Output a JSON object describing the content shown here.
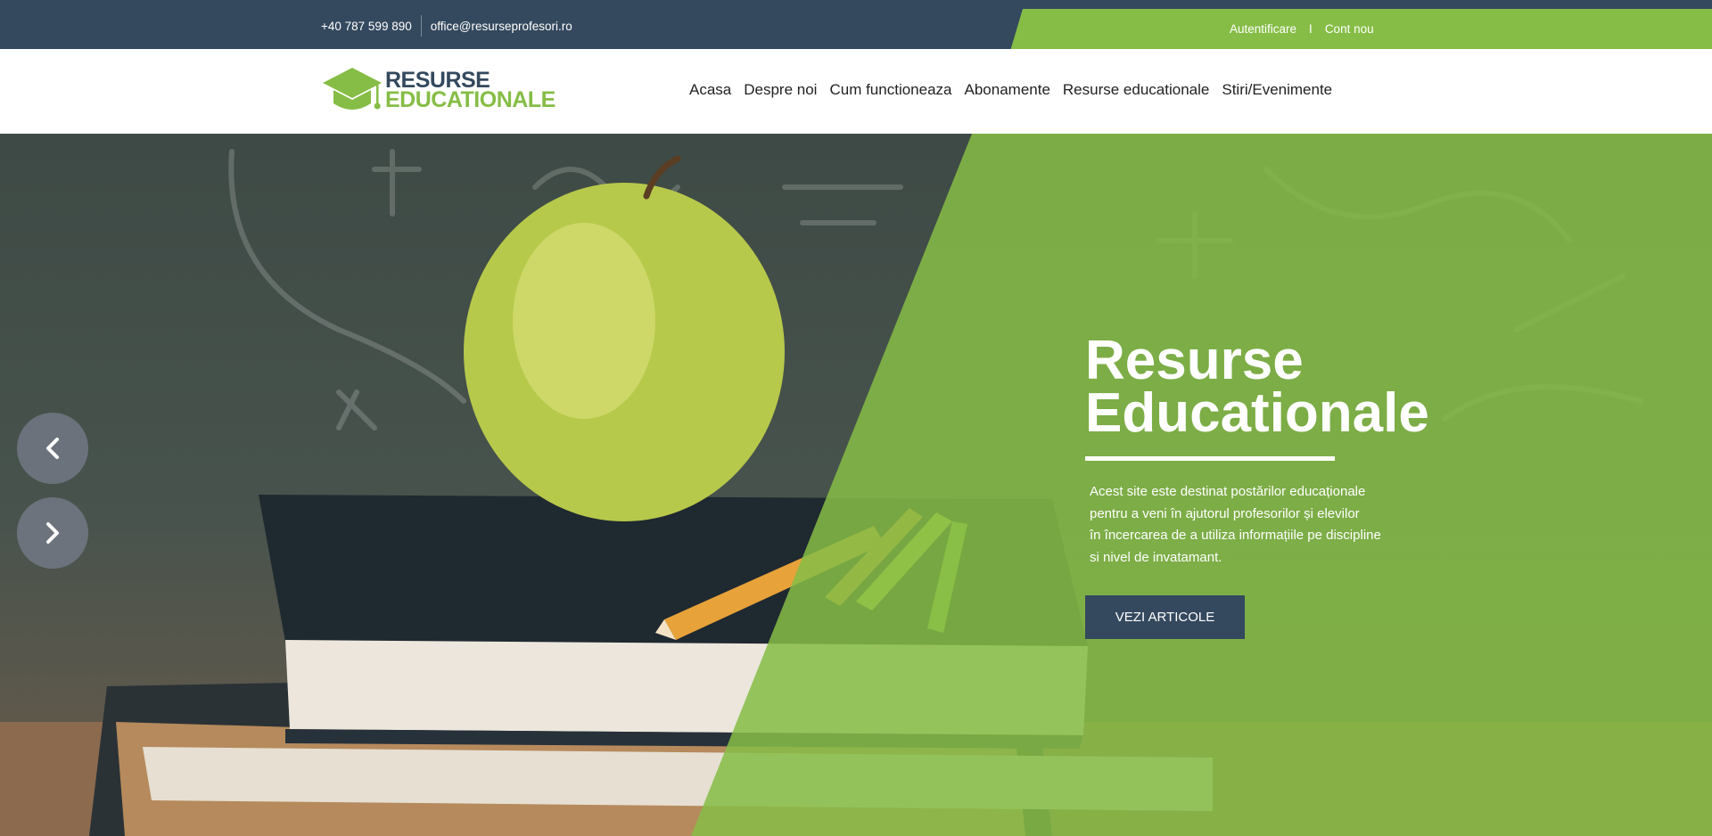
{
  "topbar": {
    "phone": "+40 787 599 890",
    "email": "office@resurseprofesori.ro",
    "login": "Autentificare",
    "separator": "I",
    "register": "Cont nou"
  },
  "logo": {
    "line1": "RESURSE",
    "line2": "EDUCATIONALE"
  },
  "nav": {
    "items": [
      {
        "label": "Acasa"
      },
      {
        "label": "Despre noi"
      },
      {
        "label": "Cum functioneaza"
      },
      {
        "label": "Abonamente"
      },
      {
        "label": "Resurse educationale"
      },
      {
        "label": "Stiri/Evenimente"
      }
    ]
  },
  "hero": {
    "title": "Resurse Educationale",
    "description": "Acest site este destinat postărilor educaționale\npentru a veni în ajutorul profesorilor și elevilor\nîn încercarea de a utiliza informațiile pe discipline\nsi nivel de invatamant.",
    "cta": "VEZI ARTICOLE",
    "prev_icon": "chevron-left-icon",
    "next_icon": "chevron-right-icon"
  },
  "colors": {
    "navy": "#34495e",
    "green": "#86bd46",
    "white": "#ffffff"
  }
}
